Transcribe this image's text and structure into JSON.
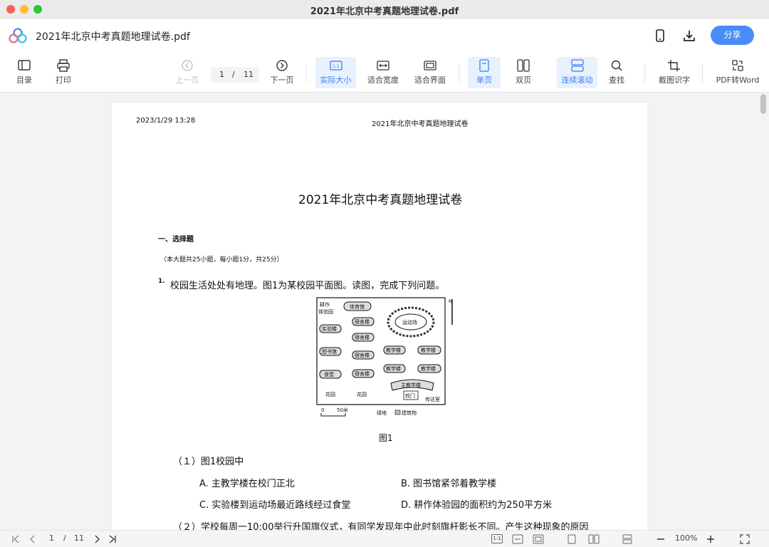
{
  "window": {
    "title": "2021年北京中考真题地理试卷.pdf"
  },
  "appbar": {
    "doc_name": "2021年北京中考真题地理试卷.pdf",
    "share_label": "分享"
  },
  "toolbar": {
    "toc": "目录",
    "print": "打印",
    "prev": "上一页",
    "current_page": "1",
    "page_sep": "/",
    "total_pages": "11",
    "next": "下一页",
    "actual_size": "实际大小",
    "actual_size_glyph": "1:1",
    "fit_width": "适合宽度",
    "fit_page": "适合界面",
    "single": "单页",
    "double": "双页",
    "continuous": "连续滚动",
    "find": "查找",
    "ocr": "截图识字",
    "pdf_to_word": "PDF转Word"
  },
  "page": {
    "header_date": "2023/1/29 13:28",
    "header_title": "2021年北京中考真题地理试卷",
    "title": "2021年北京中考真题地理试卷",
    "section": "一、选择题",
    "section_note": "（本大题共25小题，每小题1分，共25分）",
    "q1_num": "1.",
    "q1_text": "校园生活处处有地理。图1为某校园平面图。读图，完成下列问题。",
    "figure": {
      "caption": "图1",
      "north": "N",
      "labels": {
        "farm": "耕作",
        "farm2": "体验园",
        "gym": "体育馆",
        "lab": "实验楼",
        "library": "图书馆",
        "canteen": "食堂",
        "teach_main": "主教学楼",
        "gate": "校门",
        "guard": "传达室",
        "garden1": "花园",
        "garden2": "花园",
        "sports": "运动场",
        "dorm1": "宿舍楼",
        "dorm2": "宿舍楼",
        "dorm3": "宿舍楼",
        "dorm4": "宿舍楼",
        "teach1": "教学楼",
        "teach2": "教学楼",
        "teach3": "教学楼",
        "teach4": "教学楼",
        "scale_zero": "0",
        "scale_len": "50米",
        "legend_green": "绿地",
        "legend_building": "建筑物"
      }
    },
    "sub1": "（１）图1校园中",
    "opt_a": "A. 主教学楼在校门正北",
    "opt_b": "B. 图书馆紧邻着教学楼",
    "opt_c": "C. 实验楼到运动场最近路线经过食堂",
    "opt_d": "D. 耕作体验园的面积约为250平方米",
    "sub2": "（２）学校每周一10:00举行升国旗仪式，有同学发现年中此时刻旗杆影长不同。产生这种现象的原因"
  },
  "statusbar": {
    "current_page": "1",
    "page_sep": "/",
    "total_pages": "11",
    "zoom": "100%",
    "actual_size_glyph": "1:1"
  },
  "colors": {
    "accent": "#4a8cf7",
    "active_bg": "#e8f1fe"
  },
  "icons": [
    "logo-icon",
    "phone-icon",
    "download-icon",
    "toc-icon",
    "print-icon",
    "prev-page-icon",
    "next-page-icon",
    "actual-size-icon",
    "fit-width-icon",
    "fit-page-icon",
    "single-page-icon",
    "double-page-icon",
    "continuous-scroll-icon",
    "search-icon",
    "crop-ocr-icon",
    "pdf-to-word-icon",
    "first-page-icon",
    "last-page-icon",
    "zoom-out-icon",
    "zoom-in-icon",
    "fullscreen-icon"
  ]
}
